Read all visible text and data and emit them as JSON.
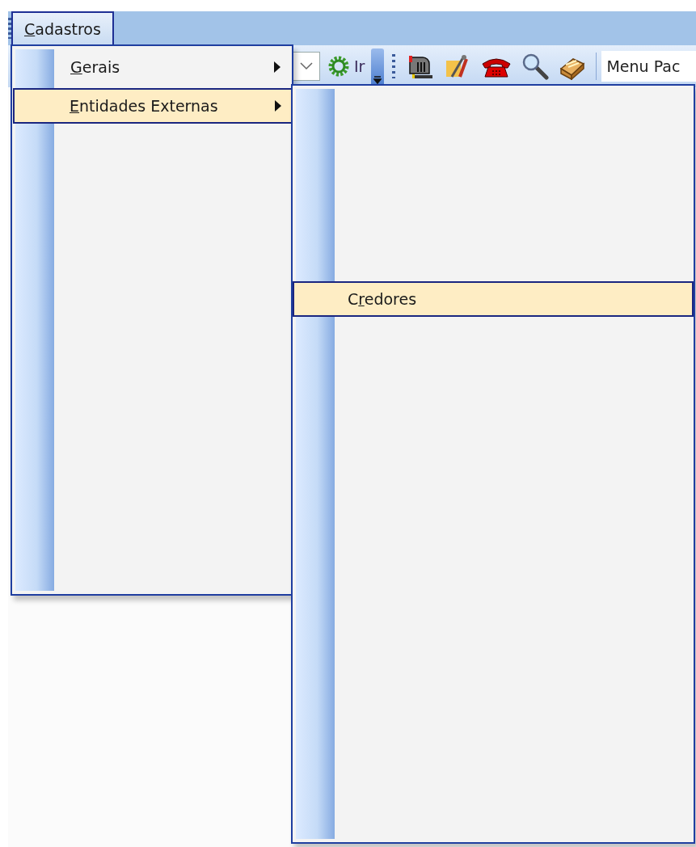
{
  "menu_bar": {
    "items": [
      {
        "label": [
          {
            "text": "C",
            "underlined": true
          },
          {
            "text": "adastros",
            "underlined": false
          }
        ],
        "selected": true
      }
    ]
  },
  "toolbar": {
    "go_label": "Ir",
    "search_field": {
      "value": "Menu Pac"
    }
  },
  "menus": [
    {
      "items": [
        {
          "label": [
            {
              "text": "G",
              "underlined": true
            },
            {
              "text": "erais",
              "underlined": false
            }
          ],
          "submenu": true,
          "selected": false
        },
        {
          "label": [
            {
              "text": "E",
              "underlined": true
            },
            {
              "text": "ntidades Externas",
              "underlined": false
            }
          ],
          "submenu": true,
          "selected": true
        }
      ]
    },
    {
      "items": [
        {
          "label": [
            {
              "text": "C",
              "underlined": false
            },
            {
              "text": "r",
              "underlined": true
            },
            {
              "text": "edores",
              "underlined": false
            }
          ],
          "submenu": false,
          "selected": true
        }
      ]
    }
  ]
}
